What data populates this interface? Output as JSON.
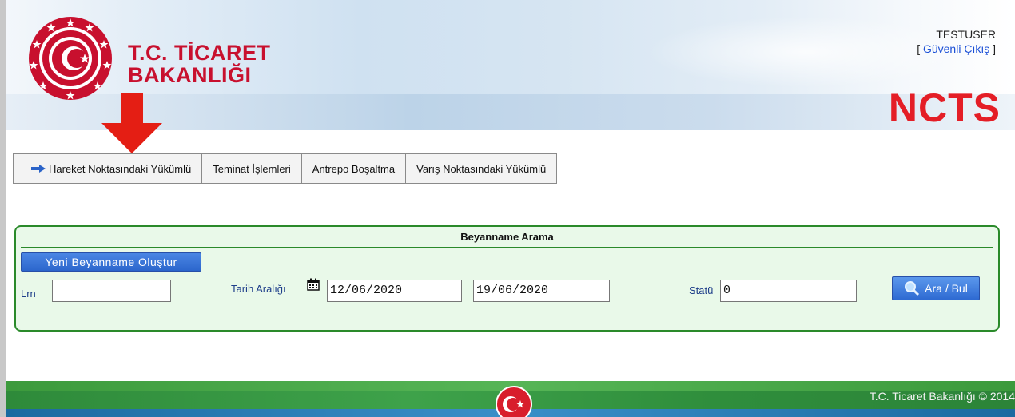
{
  "header": {
    "logo_line1": "T.C. TİCARET",
    "logo_line2": "BAKANLIĞI",
    "app_name": "NCTS",
    "username": "TESTUSER",
    "logout_open": "[ ",
    "logout_label": "Güvenli Çıkış",
    "logout_close": " ]"
  },
  "nav": {
    "items": [
      {
        "label": "Hareket Noktasındaki Yükümlü"
      },
      {
        "label": "Teminat İşlemleri"
      },
      {
        "label": "Antrepo Boşaltma"
      },
      {
        "label": "Varış Noktasındaki Yükümlü"
      }
    ]
  },
  "search": {
    "title": "Beyanname Arama",
    "new_button": "Yeni Beyanname Oluştur",
    "lrn_label": "Lrn",
    "lrn_value": "",
    "date_label": "Tarih Aralığı",
    "date_from": "12/06/2020",
    "date_to": "19/06/2020",
    "status_label": "Statü",
    "status_value": "0",
    "search_button": "Ara / Bul"
  },
  "footer": {
    "copyright": "T.C. Ticaret Bakanlığı © 2014"
  },
  "colors": {
    "brand_red": "#c8102e",
    "ncts_red": "#e41e26",
    "panel_border": "#2a8a2a",
    "panel_bg": "#e9f9e9",
    "button_blue": "#2c66cc"
  }
}
